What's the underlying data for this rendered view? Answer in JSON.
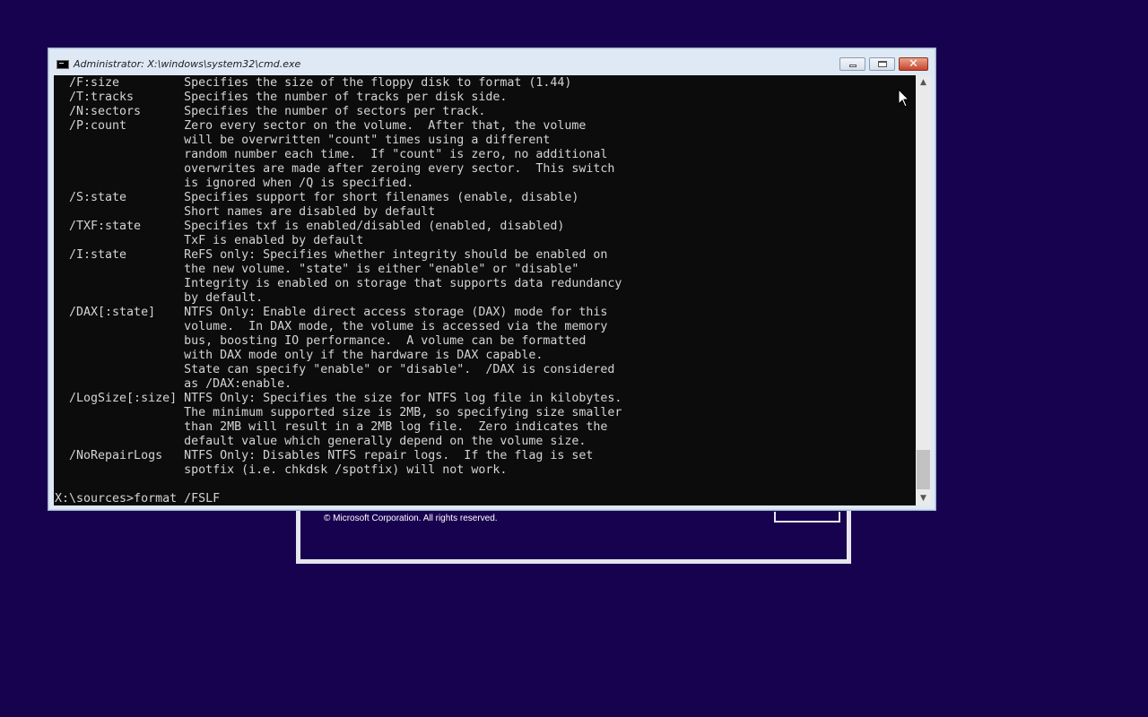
{
  "setup_dialog": {
    "copyright": "© Microsoft Corporation. All rights reserved."
  },
  "window": {
    "title": "Administrator: X:\\windows\\system32\\cmd.exe",
    "icon": "cmd-icon",
    "close_glyph": "✕"
  },
  "console": {
    "lines": [
      "  /F:size         Specifies the size of the floppy disk to format (1.44)",
      "  /T:tracks       Specifies the number of tracks per disk side.",
      "  /N:sectors      Specifies the number of sectors per track.",
      "  /P:count        Zero every sector on the volume.  After that, the volume",
      "                  will be overwritten \"count\" times using a different",
      "                  random number each time.  If \"count\" is zero, no additional",
      "                  overwrites are made after zeroing every sector.  This switch",
      "                  is ignored when /Q is specified.",
      "  /S:state        Specifies support for short filenames (enable, disable)",
      "                  Short names are disabled by default",
      "  /TXF:state      Specifies txf is enabled/disabled (enabled, disabled)",
      "                  TxF is enabled by default",
      "  /I:state        ReFS only: Specifies whether integrity should be enabled on",
      "                  the new volume. \"state\" is either \"enable\" or \"disable\"",
      "                  Integrity is enabled on storage that supports data redundancy",
      "                  by default.",
      "  /DAX[:state]    NTFS Only: Enable direct access storage (DAX) mode for this",
      "                  volume.  In DAX mode, the volume is accessed via the memory",
      "                  bus, boosting IO performance.  A volume can be formatted",
      "                  with DAX mode only if the hardware is DAX capable.",
      "                  State can specify \"enable\" or \"disable\".  /DAX is considered",
      "                  as /DAX:enable.",
      "  /LogSize[:size] NTFS Only: Specifies the size for NTFS log file in kilobytes.",
      "                  The minimum supported size is 2MB, so specifying size smaller",
      "                  than 2MB will result in a 2MB log file.  Zero indicates the",
      "                  default value which generally depend on the volume size.",
      "  /NoRepairLogs   NTFS Only: Disables NTFS repair logs.  If the flag is set",
      "                  spotfix (i.e. chkdsk /spotfix) will not work.",
      "",
      "X:\\sources>format /FSLF"
    ]
  },
  "scrollbar": {
    "up_arrow": "▲",
    "down_arrow": "▼"
  }
}
